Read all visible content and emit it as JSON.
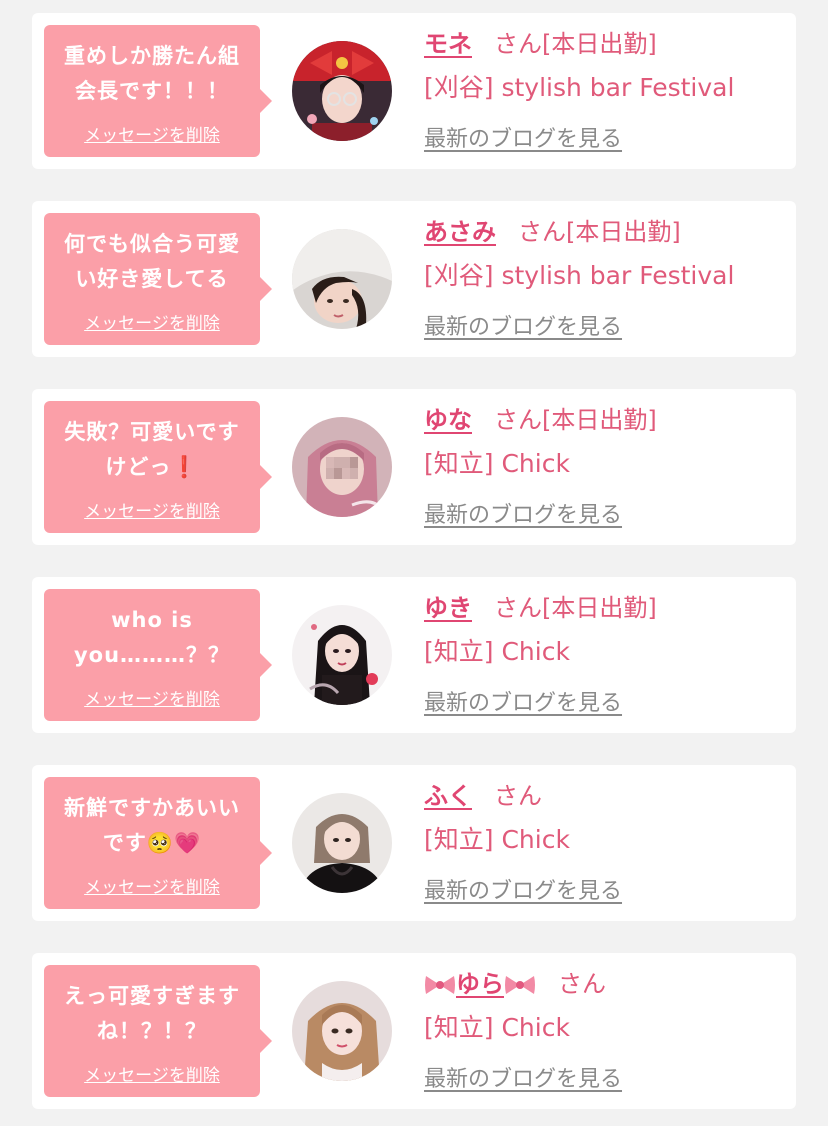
{
  "colors": {
    "page_background": "#f2f2f2",
    "card_background": "#ffffff",
    "bubble": "#fb9fa8",
    "name": "#e04672",
    "text_pink": "#e05a7a",
    "link_gray": "#8a8a8a"
  },
  "messages": [
    {
      "message": "重めしか勝たん組\n会長です！！！",
      "delete_label": "メッセージを削除",
      "name": "モネ",
      "name_decoration": "",
      "honorific": "さん",
      "status": "[本日出勤]",
      "shop": "[刈谷] stylish bar Festival",
      "blog_label": "最新のブログを見る",
      "avatar_icon": "cast-photo-red-bow"
    },
    {
      "message": "何でも似合う可愛\nい好き愛してる",
      "delete_label": "メッセージを削除",
      "name": "あさみ",
      "name_decoration": "",
      "honorific": "さん",
      "status": "[本日出勤]",
      "shop": "[刈谷] stylish bar Festival",
      "blog_label": "最新のブログを見る",
      "avatar_icon": "cast-photo-white-hat"
    },
    {
      "message": "失敗？可愛いです\nけどっ❗",
      "delete_label": "メッセージを削除",
      "name": "ゆな",
      "name_decoration": "",
      "honorific": "さん",
      "status": "[本日出勤]",
      "shop": "[知立] Chick",
      "blog_label": "最新のブログを見る",
      "avatar_icon": "cast-photo-pink-hair"
    },
    {
      "message": "who is\nyou………？？",
      "delete_label": "メッセージを削除",
      "name": "ゆき",
      "name_decoration": "",
      "honorific": "さん",
      "status": "[本日出勤]",
      "shop": "[知立] Chick",
      "blog_label": "最新のブログを見る",
      "avatar_icon": "cast-photo-birthday"
    },
    {
      "message": "新鮮ですかあいい\nです🥺💗",
      "delete_label": "メッセージを削除",
      "name": "ふく",
      "name_decoration": "",
      "honorific": "さん",
      "status": "",
      "shop": "[知立] Chick",
      "blog_label": "最新のブログを見る",
      "avatar_icon": "cast-photo-black-dress"
    },
    {
      "message": "えっ可愛すぎます\nね！？！？",
      "delete_label": "メッセージを削除",
      "name": "ゆら",
      "name_decoration": "ribbon-bow-icon",
      "honorific": "さん",
      "status": "",
      "shop": "[知立] Chick",
      "blog_label": "最新のブログを見る",
      "avatar_icon": "cast-photo-brown-hair"
    }
  ]
}
